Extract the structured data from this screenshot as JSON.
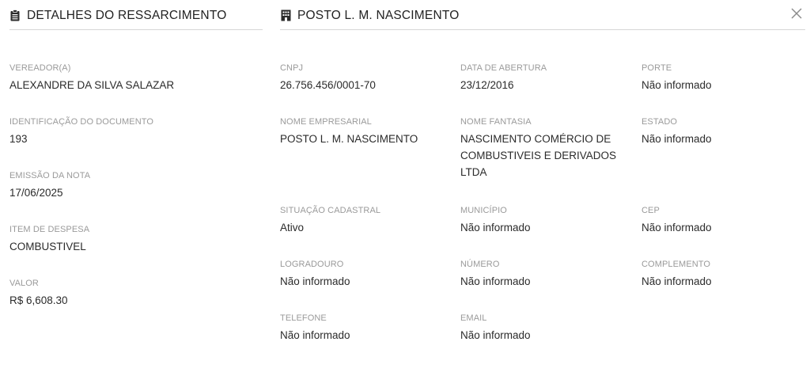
{
  "left": {
    "title": "DETALHES DO RESSARCIMENTO",
    "icon": "clipboard-icon",
    "fields": [
      {
        "label": "VEREADOR(A)",
        "value": "ALEXANDRE DA SILVA SALAZAR"
      },
      {
        "label": "IDENTIFICAÇÃO DO DOCUMENTO",
        "value": "193"
      },
      {
        "label": "EMISSÃO DA NOTA",
        "value": "17/06/2025"
      },
      {
        "label": "ITEM DE DESPESA",
        "value": "COMBUSTIVEL"
      },
      {
        "label": "VALOR",
        "value": "R$ 6,608.30"
      }
    ]
  },
  "right": {
    "title": "POSTO L. M. NASCIMENTO",
    "icon": "building-icon",
    "fields": [
      {
        "label": "CNPJ",
        "value": "26.756.456/0001-70"
      },
      {
        "label": "DATA DE ABERTURA",
        "value": "23/12/2016"
      },
      {
        "label": "PORTE",
        "value": "Não informado"
      },
      {
        "label": "NOME EMPRESARIAL",
        "value": "POSTO L. M. NASCIMENTO"
      },
      {
        "label": "NOME FANTASIA",
        "value": "NASCIMENTO COMÉRCIO DE COMBUSTIVEIS E DERIVADOS LTDA"
      },
      {
        "label": "ESTADO",
        "value": "Não informado"
      },
      {
        "label": "SITUAÇÃO CADASTRAL",
        "value": "Ativo"
      },
      {
        "label": "MUNICÍPIO",
        "value": "Não informado"
      },
      {
        "label": "CEP",
        "value": "Não informado"
      },
      {
        "label": "LOGRADOURO",
        "value": "Não informado"
      },
      {
        "label": "NÚMERO",
        "value": "Não informado"
      },
      {
        "label": "COMPLEMENTO",
        "value": "Não informado"
      },
      {
        "label": "TELEFONE",
        "value": "Não informado"
      },
      {
        "label": "EMAIL",
        "value": "Não informado"
      }
    ]
  },
  "close_icon": "close-icon"
}
